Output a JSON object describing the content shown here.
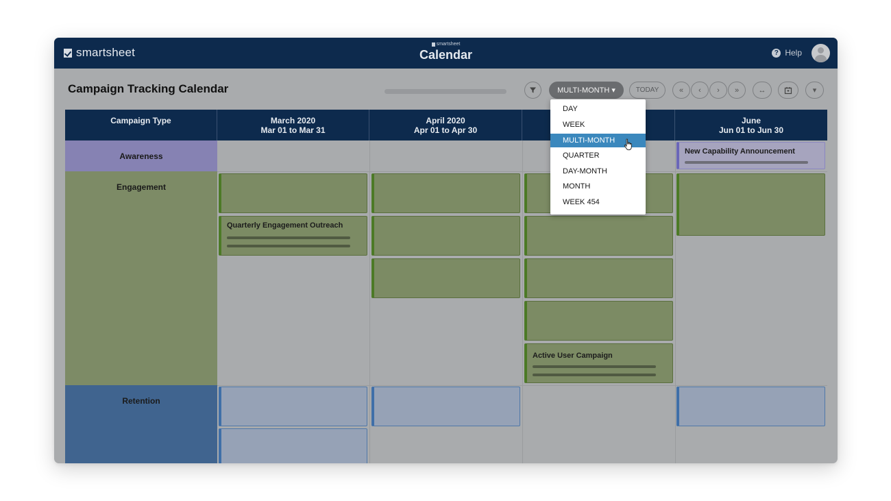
{
  "app": {
    "brand": "smartsheet",
    "center_small": "smartsheet",
    "center_title": "Calendar",
    "help_label": "Help"
  },
  "toolbar": {
    "title": "Campaign Tracking Calendar",
    "view_button": "MULTI-MONTH ▾",
    "today_button": "TODAY",
    "nav": [
      "«",
      "‹",
      "›",
      "»"
    ],
    "expand_glyph": "↔",
    "more_glyph": "▾"
  },
  "grid": {
    "headers": [
      {
        "line1": "Campaign Type",
        "line2": ""
      },
      {
        "line1": "March 2020",
        "line2": "Mar 01 to Mar 31"
      },
      {
        "line1": "April 2020",
        "line2": "Apr 01 to Apr 30"
      },
      {
        "line1": "",
        "line2": ""
      },
      {
        "line1": "June",
        "line2": "Jun 01 to Jun 30"
      }
    ],
    "rows": [
      "Awareness",
      "Engagement",
      "Retention"
    ],
    "cards": {
      "new_capability": "New Capability Announcement",
      "quarterly_engagement": "Quarterly Engagement Outreach",
      "active_user": "Active User Campaign"
    }
  },
  "dropdown": {
    "items": [
      "DAY",
      "WEEK",
      "MULTI-MONTH",
      "QUARTER",
      "DAY-MONTH",
      "MONTH",
      "WEEK 454"
    ],
    "selected": "MULTI-MONTH"
  },
  "colors": {
    "navy": "#0d2a4d",
    "awareness": "#8682b3",
    "engagement": "#7d8b66",
    "retention": "#40648f",
    "selected": "#3b88bd"
  }
}
